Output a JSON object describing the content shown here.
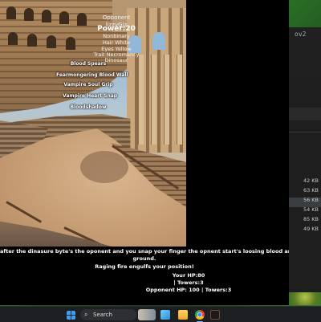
{
  "background_window": {
    "title_fragment": "ov2",
    "file_sizes": [
      "42 KB",
      "63 KB",
      "56 KB",
      "54 KB",
      "85 KB",
      "49 KB"
    ]
  },
  "game": {
    "opponent_label": "Opponent",
    "opponent_name": "lizzyGiz",
    "power": "Power:20",
    "attributes": [
      "Nonbinary",
      "Hair White",
      "Eyes Yellow",
      "Trait Necromancy",
      "Dinosaur"
    ],
    "abilities": [
      "Blood Spears",
      "Fearmongering Blood Wall",
      "Vampire Soul Grip",
      "Vampire Heart Snap",
      "Bloodshadow"
    ],
    "story": {
      "line1": "after the dinasure byte's the oponent and you snap your finger the opnent start's loosing blood and both them and their c",
      "line2": "ground.",
      "line3": "Raging fire engulfs your position!"
    },
    "stats": {
      "your_hp": "Your HP:80",
      "your_towers": "| Towers:3",
      "opponent": "Opponent HP: 100 | Towers:3"
    }
  },
  "taskbar": {
    "search_label": "Search",
    "icons": [
      "windows-start-icon",
      "search-icon",
      "file-explorer-icon",
      "folder-icon",
      "chrome-icon",
      "game-icon"
    ]
  },
  "colors": {
    "taskbar_bg": "#1d1f22",
    "game_bg": "#000000",
    "text": "#ffffff"
  }
}
